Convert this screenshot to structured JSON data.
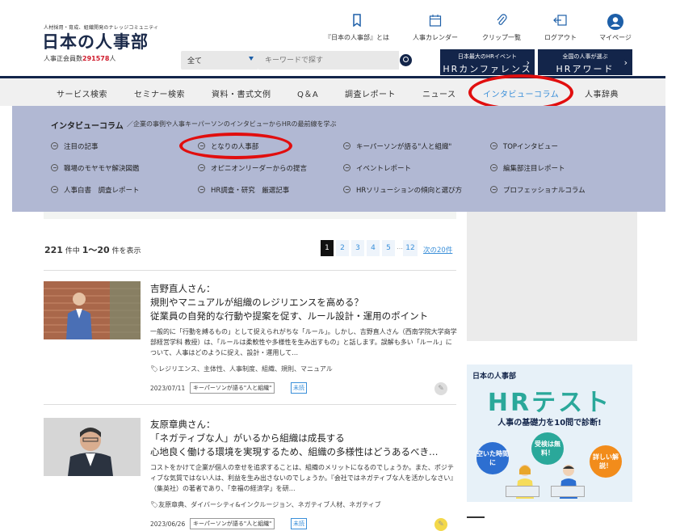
{
  "header": {
    "tagline": "人材採用・育成、組織開発のナレッジコミュニティ",
    "logo": "日本の人事部",
    "members_label": "人事正会員数",
    "members_count": "291578",
    "members_unit": "人",
    "search_category": "全て",
    "search_placeholder": "キーワードで探す",
    "top_links": [
      {
        "label": "『日本の人事部』とは",
        "icon": "book-icon"
      },
      {
        "label": "人事カレンダー",
        "icon": "calendar-icon"
      },
      {
        "label": "クリップ一覧",
        "icon": "paperclip-icon"
      },
      {
        "label": "ログアウト",
        "icon": "logout-icon"
      },
      {
        "label": "マイページ",
        "icon": "user-icon"
      }
    ],
    "banners": [
      {
        "small": "日本最大のHRイベント",
        "big": "HRカンファレンス"
      },
      {
        "small": "全国の人事が選ぶ",
        "big": "HRアワード"
      }
    ]
  },
  "nav": {
    "items": [
      "サービス検索",
      "セミナー検索",
      "資料・書式文例",
      "Q＆A",
      "調査レポート",
      "ニュース",
      "インタビューコラム",
      "人事辞典"
    ],
    "active_index": 6
  },
  "mega_menu": {
    "title": "インタビューコラム",
    "description": "／企業の事例や人事キーパーソンのインタビューからHRの最前線を学ぶ",
    "items": [
      "注目の記事",
      "となりの人事部",
      "キーパーソンが語る\"人と組織\"",
      "TOPインタビュー",
      "職場のモヤモヤ解決図鑑",
      "オピニオンリーダーからの提言",
      "イベントレポート",
      "編集部注目レポート",
      "人事白書　調査レポート",
      "HR調査・研究　厳選記事",
      "HRソリューションの傾向と選び方",
      "プロフェッショナルコラム"
    ]
  },
  "listing": {
    "total": "221",
    "summary_mid": " 件中 ",
    "range": "1〜20",
    "summary_end": " 件を表示",
    "pages": [
      "1",
      "2",
      "3",
      "4",
      "5",
      "12"
    ],
    "ellipsis": "…",
    "next": "次の20件"
  },
  "articles": [
    {
      "person": "吉野直人さん：",
      "title": "規則やマニュアルが組織のレジリエンスを高める？",
      "subtitle": "従業員の自発的な行動や提案を促す、ルール設計・運用のポイント",
      "excerpt": "一般的に「行動を縛るもの」として捉えられがちな「ルール」。しかし、吉野直人さん（西南学院大学商学部経営学科 教授）は、「ルールは柔軟性や多様性を生み出すもの」と話します。誤解も多い「ルール」について、人事はどのように捉え、設計・運用して…",
      "tags": "レジリエンス、主体性、人事制度、組織、規則、マニュアル",
      "date": "2023/07/11",
      "category": "キーパーソンが語る\"人と組織\"",
      "label": "未読"
    },
    {
      "person": "友原章典さん：",
      "title": "「ネガティブな人」がいるから組織は成長する",
      "subtitle": "心地良く働ける環境を実現するため、組織の多様性はどうあるべき…",
      "excerpt": "コストをかけて企業が個人の幸せを追求することは、組織のメリットになるのでしょうか。また、ポジティブな気質ではない人は、利益を生み出さないのでしょうか。『会社ではネガティブな人を活かしなさい』（集英社）の著者であり、「幸福の経済学」を研…",
      "tags": "友原章典、ダイバーシティ&インクルージョン、ネガティブ人材、ネガティブ",
      "date": "2023/06/26",
      "category": "キーパーソンが語る\"人と組織\"",
      "label": "未読"
    }
  ],
  "sidebar_ad": {
    "brand": "日本の人事部",
    "title": "HRテスト",
    "subtitle": "人事の基礎力を10問で診断!",
    "bubbles": [
      "空いた時間に",
      "受検は無料！",
      "詳しい解説！"
    ]
  },
  "colors": {
    "navy": "#13254a",
    "accent": "#3a8fd9",
    "highlight": "#e10e0e",
    "mega_bg": "#b1b8d3"
  }
}
